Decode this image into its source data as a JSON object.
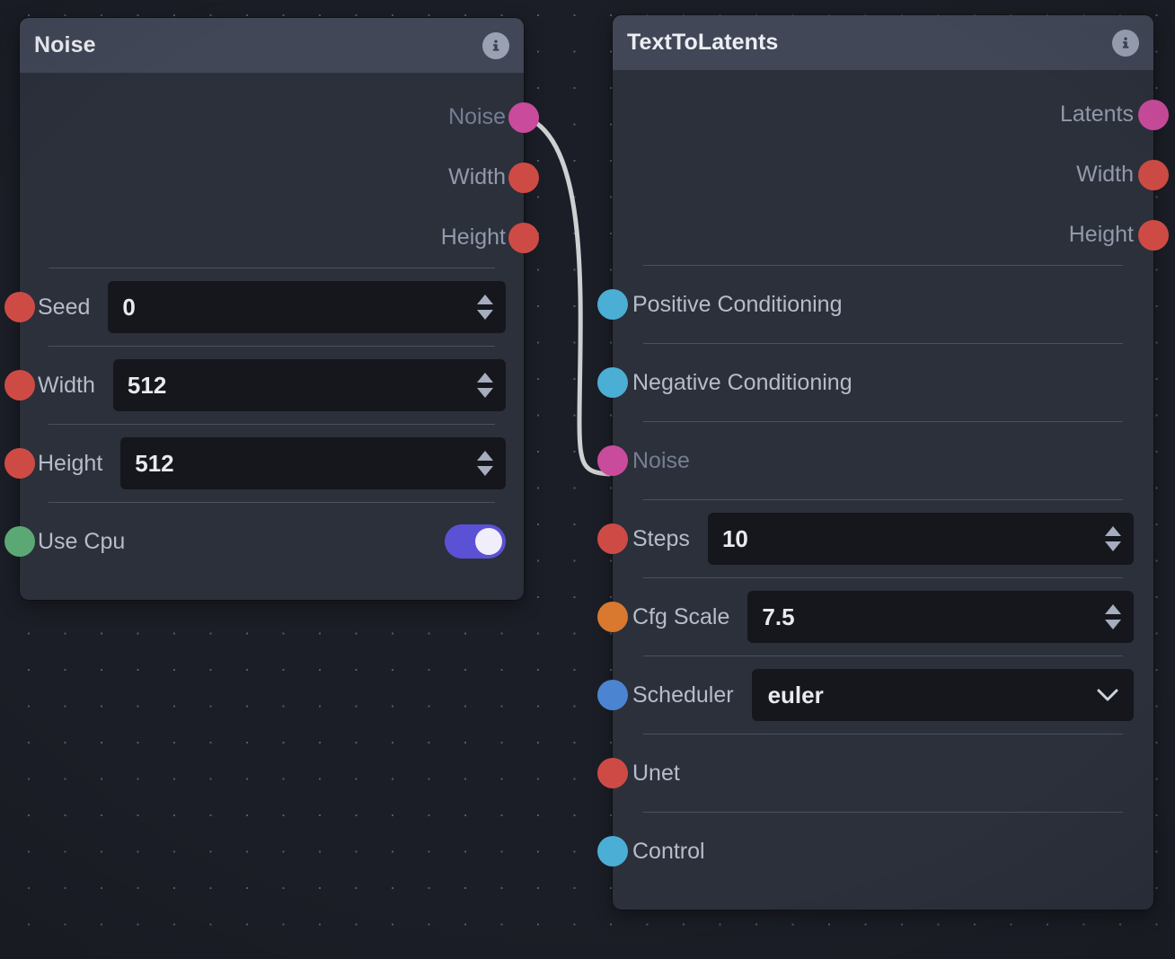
{
  "canvas": {
    "background_color": "#1b1e26",
    "dot_color": "#55596b"
  },
  "palette": {
    "node_body": "#2b303b",
    "node_header": "#414757",
    "field_background": "#15171d",
    "divider": "#4a505e",
    "label_text": "#b6bcca",
    "dim_text": "#767f92",
    "value_text": "#e8eaf0",
    "edge_wire": "#cfd0d2",
    "toggle_on": "#5b51d4",
    "port_latents": "#c94b9b",
    "port_integer": "#ce4b45",
    "port_boolean": "#5ca874",
    "port_conditioning": "#4baed5",
    "port_float": "#d9782f",
    "port_scheduler": "#4b84d1"
  },
  "edges": [
    {
      "name": "noise-to-latents-edge",
      "from_node": "Noise",
      "from_port": "Noise",
      "to_node": "TextToLatents",
      "to_port": "Noise",
      "color": "#cfd0d2"
    }
  ],
  "nodes": [
    {
      "id": "noise",
      "title": "Noise",
      "info_icon": "info-icon",
      "outputs": [
        {
          "label": "Noise",
          "port_color": "#c94b9b",
          "dim": true,
          "connected": true
        },
        {
          "label": "Width",
          "port_color": "#ce4b45",
          "dim": false,
          "connected": false
        },
        {
          "label": "Height",
          "port_color": "#ce4b45",
          "dim": false,
          "connected": false
        }
      ],
      "inputs": [
        {
          "label": "Seed",
          "port_color": "#ce4b45",
          "control": "number",
          "value": "0"
        },
        {
          "label": "Width",
          "port_color": "#ce4b45",
          "control": "number",
          "value": "512"
        },
        {
          "label": "Height",
          "port_color": "#ce4b45",
          "control": "number",
          "value": "512"
        },
        {
          "label": "Use Cpu",
          "port_color": "#5ca874",
          "control": "toggle",
          "value": "on"
        }
      ]
    },
    {
      "id": "t2l",
      "title": "TextToLatents",
      "info_icon": "info-icon",
      "outputs": [
        {
          "label": "Latents",
          "port_color": "#c94b9b",
          "dim": false,
          "connected": false
        },
        {
          "label": "Width",
          "port_color": "#ce4b45",
          "dim": false,
          "connected": false
        },
        {
          "label": "Height",
          "port_color": "#ce4b45",
          "dim": false,
          "connected": false
        }
      ],
      "inputs": [
        {
          "label": "Positive Conditioning",
          "port_color": "#4baed5",
          "control": "none",
          "value": ""
        },
        {
          "label": "Negative Conditioning",
          "port_color": "#4baed5",
          "control": "none",
          "value": ""
        },
        {
          "label": "Noise",
          "port_color": "#c94b9b",
          "control": "none",
          "value": "",
          "dim": true
        },
        {
          "label": "Steps",
          "port_color": "#ce4b45",
          "control": "number",
          "value": "10"
        },
        {
          "label": "Cfg Scale",
          "port_color": "#d9782f",
          "control": "number",
          "value": "7.5"
        },
        {
          "label": "Scheduler",
          "port_color": "#4b84d1",
          "control": "select",
          "value": "euler"
        },
        {
          "label": "Unet",
          "port_color": "#ce4b45",
          "control": "none",
          "value": ""
        },
        {
          "label": "Control",
          "port_color": "#4baed5",
          "control": "none",
          "value": ""
        }
      ]
    }
  ]
}
